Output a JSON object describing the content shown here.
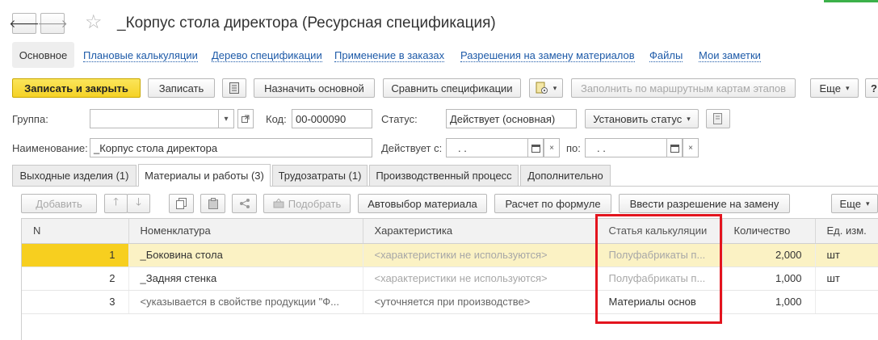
{
  "window": {
    "title": "_Корпус стола директора (Ресурсная спецификация)",
    "back_glyph": "🡐",
    "forward_glyph": "🡒",
    "star_glyph": "☆"
  },
  "nav": {
    "items": [
      {
        "label": "Основное"
      },
      {
        "label": "Плановые калькуляции"
      },
      {
        "label": "Дерево спецификации"
      },
      {
        "label": "Применение в заказах"
      },
      {
        "label": "Разрешения на замену материалов"
      },
      {
        "label": "Файлы"
      },
      {
        "label": "Мои заметки"
      }
    ]
  },
  "toolbar": {
    "save_close": "Записать и закрыть",
    "save": "Записать",
    "set_main": "Назначить основной",
    "compare": "Сравнить спецификации",
    "fill_by_route": "Заполнить по маршрутным картам этапов",
    "more": "Еще",
    "help": "?"
  },
  "form": {
    "group_label": "Группа:",
    "group_value": "",
    "code_label": "Код:",
    "code_value": "00-000090",
    "status_label": "Статус:",
    "status_value": "Действует (основная)",
    "set_status": "Установить статус",
    "name_label": "Наименование:",
    "name_value": "_Корпус стола директора",
    "valid_from_label": "Действует с:",
    "valid_from_value": ".  .",
    "valid_to_label": "по:",
    "valid_to_value": ".  ."
  },
  "tabs": [
    {
      "label": "Выходные изделия (1)"
    },
    {
      "label": "Материалы и работы (3)"
    },
    {
      "label": "Трудозатраты (1)"
    },
    {
      "label": "Производственный процесс"
    },
    {
      "label": "Дополнительно"
    }
  ],
  "table_toolbar": {
    "add": "Добавить",
    "pick": "Подобрать",
    "auto_select": "Автовыбор материала",
    "calc_formula": "Расчет по формуле",
    "enter_permission": "Ввести разрешение на замену",
    "more": "Еще"
  },
  "table": {
    "columns": [
      "N",
      "Номенклатура",
      "Характеристика",
      "Статья калькуляции",
      "Количество",
      "Ед. изм."
    ],
    "rows": [
      {
        "n": "1",
        "item": "_Боковина стола",
        "char": "<характеристики не используются>",
        "article": "Полуфабрикаты п...",
        "qty": "2,000",
        "unit": "шт"
      },
      {
        "n": "2",
        "item": "_Задняя стенка",
        "char": "<характеристики не используются>",
        "article": "Полуфабрикаты п...",
        "qty": "1,000",
        "unit": "шт"
      },
      {
        "n": "3",
        "item": "<указывается в свойстве продукции \"Ф...",
        "char": "<уточняется при производстве>",
        "article": "Материалы основ",
        "qty": "1,000",
        "unit": ""
      }
    ]
  },
  "colors": {
    "highlight_box": "#e3141e",
    "primary_button": "#f5d226",
    "selected_row": "#fbf2c4",
    "link": "#1d5aa8"
  }
}
